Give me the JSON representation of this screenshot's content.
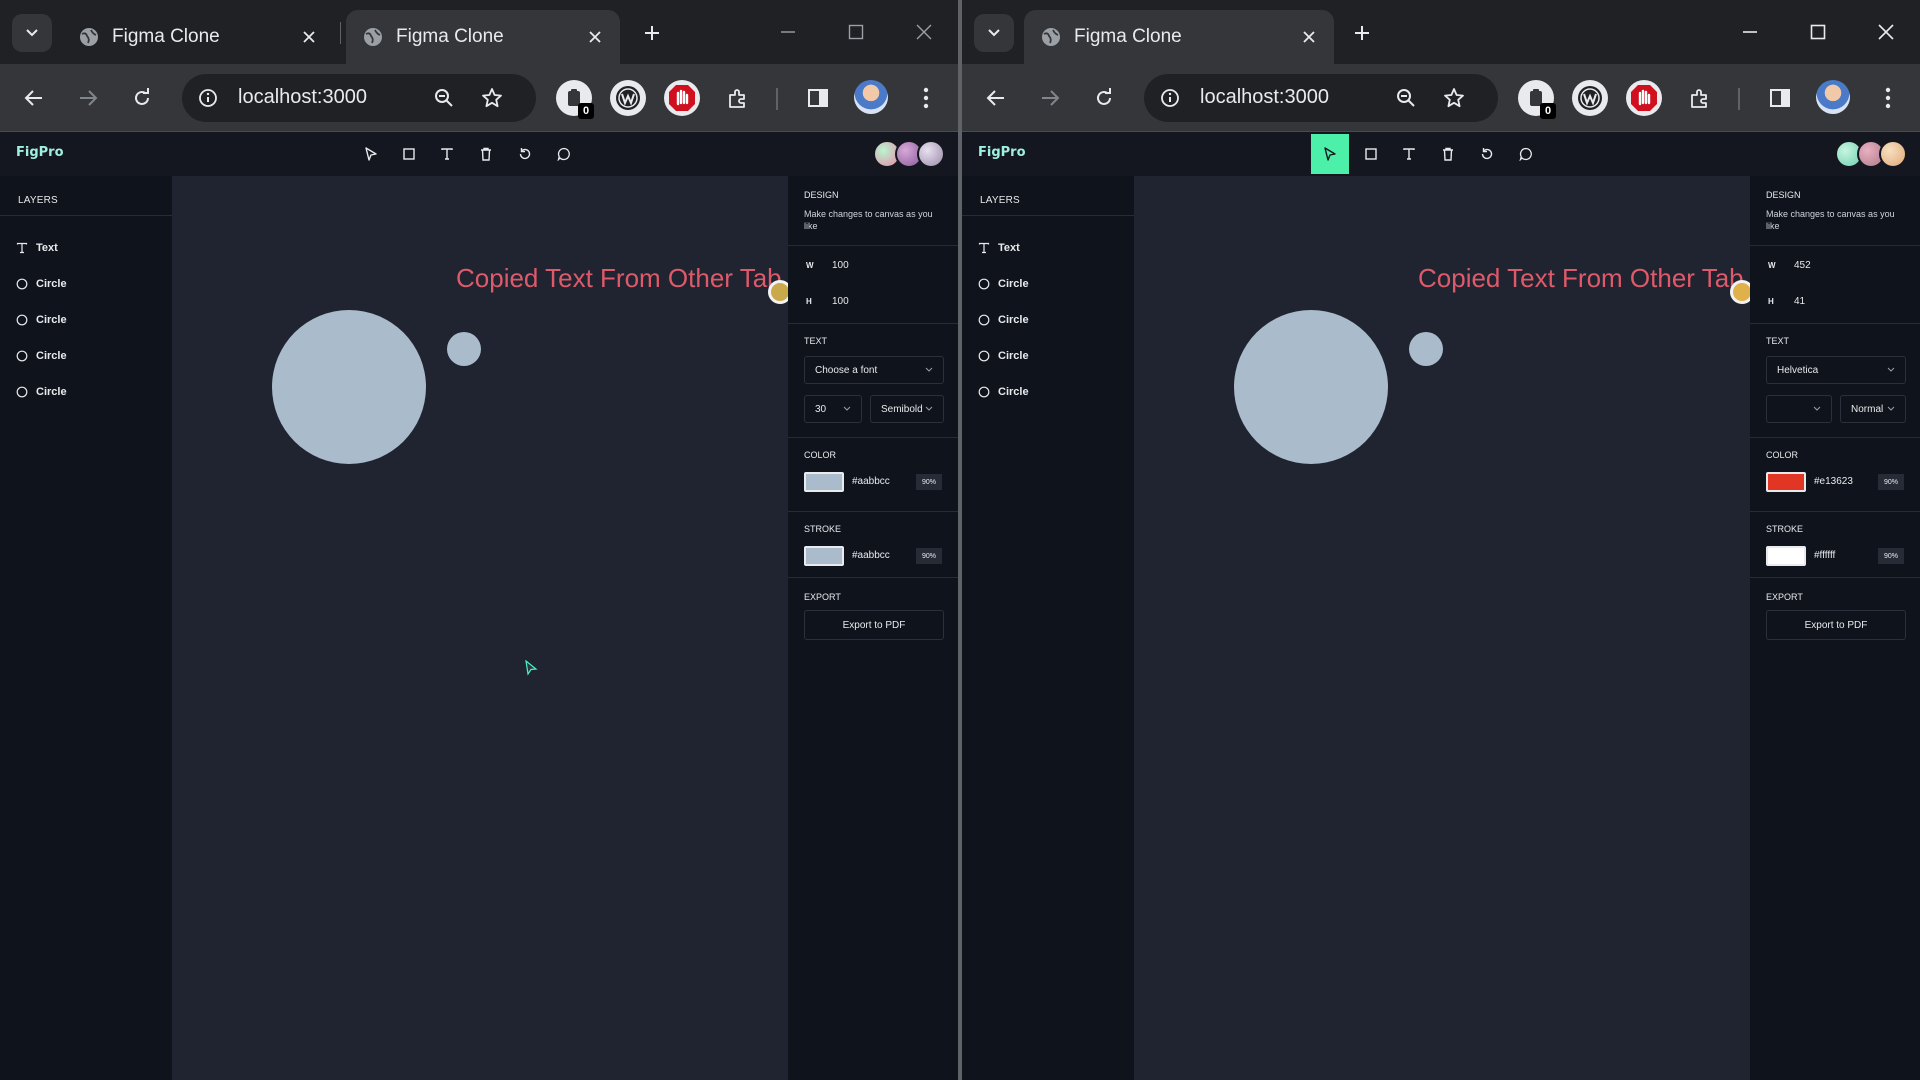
{
  "windows": [
    {
      "tabs": [
        {
          "title": "Figma Clone"
        },
        {
          "title": "Figma Clone"
        }
      ],
      "url": "localhost:3000",
      "extension_badge": "0",
      "app": {
        "logo": "FigPro",
        "layers_heading": "LAYERS",
        "layers": [
          {
            "label": "Text",
            "kind": "text"
          },
          {
            "label": "Circle",
            "kind": "circle"
          },
          {
            "label": "Circle",
            "kind": "circle"
          },
          {
            "label": "Circle",
            "kind": "circle"
          },
          {
            "label": "Circle",
            "kind": "circle"
          }
        ],
        "canvas_text": "Copied Text From Other Tab",
        "design": {
          "heading": "DESIGN",
          "subtitle": "Make changes to canvas as you like",
          "width_label": "W",
          "width": "100",
          "height_label": "H",
          "height": "100",
          "text_heading": "TEXT",
          "font_family": "Choose a font",
          "font_size": "30",
          "font_weight": "Semibold",
          "color_heading": "COLOR",
          "color_hex": "#aabbcc",
          "color_swatch": "#aabbcc",
          "color_opacity": "90%",
          "stroke_heading": "STROKE",
          "stroke_hex": "#aabbcc",
          "stroke_swatch": "#aabbcc",
          "stroke_opacity": "90%",
          "export_heading": "EXPORT",
          "export_button": "Export to PDF"
        }
      }
    },
    {
      "tabs": [
        {
          "title": "Figma Clone"
        }
      ],
      "url": "localhost:3000",
      "extension_badge": "0",
      "app": {
        "logo": "FigPro",
        "layers_heading": "LAYERS",
        "layers": [
          {
            "label": "Text",
            "kind": "text"
          },
          {
            "label": "Circle",
            "kind": "circle"
          },
          {
            "label": "Circle",
            "kind": "circle"
          },
          {
            "label": "Circle",
            "kind": "circle"
          },
          {
            "label": "Circle",
            "kind": "circle"
          }
        ],
        "canvas_text": "Copied Text From Other Tab",
        "design": {
          "heading": "DESIGN",
          "subtitle": "Make changes to canvas as you like",
          "width_label": "W",
          "width": "452",
          "height_label": "H",
          "height": "41",
          "text_heading": "TEXT",
          "font_family": "Helvetica",
          "font_size": "",
          "font_weight": "Normal",
          "color_heading": "COLOR",
          "color_hex": "#e13623",
          "color_swatch": "#e13623",
          "color_opacity": "90%",
          "stroke_heading": "STROKE",
          "stroke_hex": "#ffffff",
          "stroke_swatch": "#ffffff",
          "stroke_opacity": "90%",
          "export_heading": "EXPORT",
          "export_button": "Export to PDF"
        }
      }
    }
  ],
  "colors": {
    "accent": "#4cf0a8",
    "canvas_text": "#de5a6a",
    "shape_fill": "#aabbcc"
  }
}
